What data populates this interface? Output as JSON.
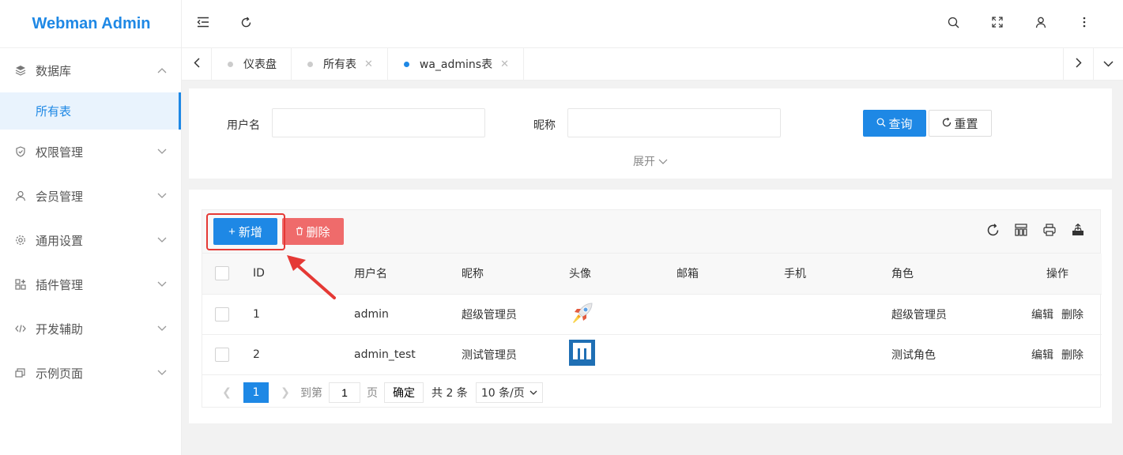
{
  "app": {
    "title": "Webman Admin"
  },
  "sidebar": {
    "items": [
      {
        "label": "数据库",
        "icon": "layers-icon",
        "expanded": true
      },
      {
        "label": "权限管理",
        "icon": "shield-icon"
      },
      {
        "label": "会员管理",
        "icon": "user-icon"
      },
      {
        "label": "通用设置",
        "icon": "gear-icon"
      },
      {
        "label": "插件管理",
        "icon": "plugin-icon"
      },
      {
        "label": "开发辅助",
        "icon": "code-icon"
      },
      {
        "label": "示例页面",
        "icon": "page-icon"
      }
    ],
    "active_sub": "所有表"
  },
  "tabs": [
    {
      "label": "仪表盘"
    },
    {
      "label": "所有表"
    },
    {
      "label": "wa_admins表",
      "active": true
    }
  ],
  "search": {
    "username_label": "用户名",
    "nickname_label": "昵称",
    "query_label": "查询",
    "reset_label": "重置",
    "expand_label": "展开"
  },
  "toolbar": {
    "add_label": "新增",
    "delete_label": "删除"
  },
  "table": {
    "headers": [
      "ID",
      "用户名",
      "昵称",
      "头像",
      "邮箱",
      "手机",
      "角色",
      "操作"
    ],
    "rows": [
      {
        "id": "1",
        "username": "admin",
        "nickname": "超级管理员",
        "avatar": "rocket-avatar",
        "email": "",
        "mobile": "",
        "role": "超级管理员",
        "edit": "编辑",
        "delete": "删除"
      },
      {
        "id": "2",
        "username": "admin_test",
        "nickname": "测试管理员",
        "avatar": "blue-logo-avatar",
        "email": "",
        "mobile": "",
        "role": "测试角色",
        "edit": "编辑",
        "delete": "删除"
      }
    ]
  },
  "pager": {
    "current": "1",
    "goto_prefix": "到第",
    "goto_value": "1",
    "goto_suffix": "页",
    "confirm": "确定",
    "total": "共 2 条",
    "page_size": "10 条/页"
  },
  "colors": {
    "primary": "#1e88e5",
    "danger": "#ef6b6b",
    "highlight": "#e53935"
  }
}
